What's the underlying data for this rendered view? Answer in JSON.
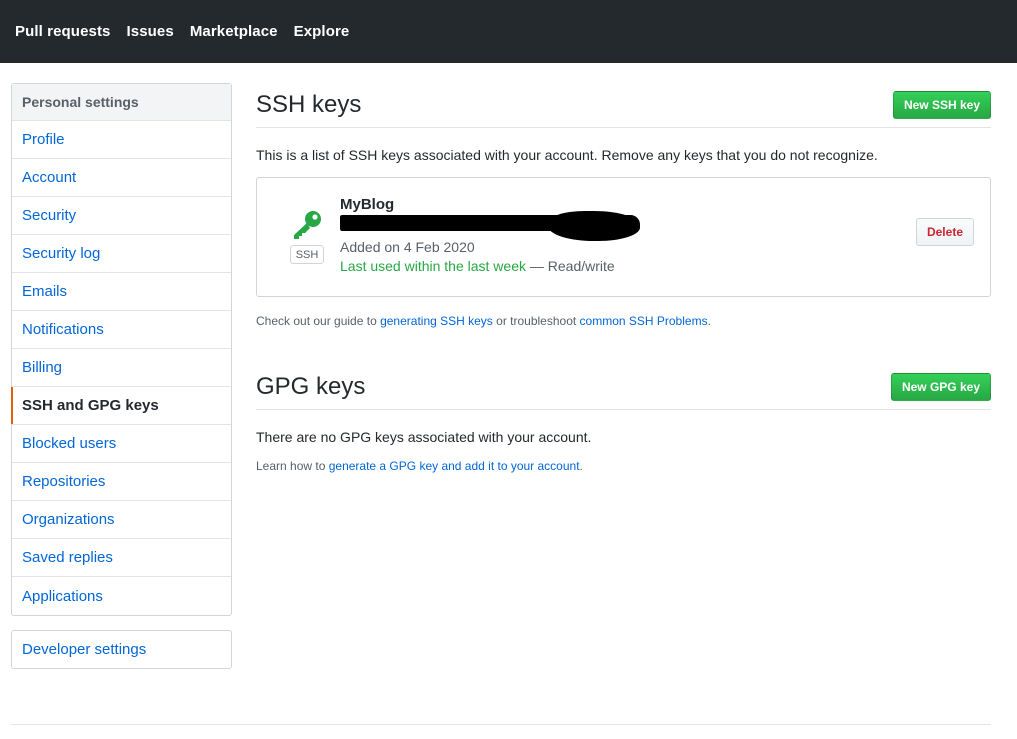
{
  "nav": {
    "items": [
      "Pull requests",
      "Issues",
      "Marketplace",
      "Explore"
    ]
  },
  "sidebar": {
    "title": "Personal settings",
    "items": [
      {
        "label": "Profile"
      },
      {
        "label": "Account"
      },
      {
        "label": "Security"
      },
      {
        "label": "Security log"
      },
      {
        "label": "Emails"
      },
      {
        "label": "Notifications"
      },
      {
        "label": "Billing"
      },
      {
        "label": "SSH and GPG keys",
        "selected": true
      },
      {
        "label": "Blocked users"
      },
      {
        "label": "Repositories"
      },
      {
        "label": "Organizations"
      },
      {
        "label": "Saved replies"
      },
      {
        "label": "Applications"
      }
    ],
    "developer": "Developer settings"
  },
  "ssh": {
    "heading": "SSH keys",
    "new_button": "New SSH key",
    "intro": "This is a list of SSH keys associated with your account. Remove any keys that you do not recognize.",
    "key": {
      "title": "MyBlog",
      "type_label": "SSH",
      "added": "Added on 4 Feb 2020",
      "last_used": "Last used within the last week",
      "access": " — Read/write",
      "delete_label": "Delete",
      "icon": "key-icon"
    },
    "guide": {
      "prefix": "Check out our guide to ",
      "link1": "generating SSH keys",
      "middle": " or troubleshoot ",
      "link2": "common SSH Problems",
      "suffix": "."
    }
  },
  "gpg": {
    "heading": "GPG keys",
    "new_button": "New GPG key",
    "empty": "There are no GPG keys associated with your account.",
    "learn": {
      "prefix": "Learn how to ",
      "link": "generate a GPG key and add it to your account",
      "suffix": "."
    }
  },
  "colors": {
    "header_bg": "#24292e",
    "link": "#0366d6",
    "green": "#28a745",
    "danger": "#cb2431",
    "selected_accent": "#e36209"
  }
}
